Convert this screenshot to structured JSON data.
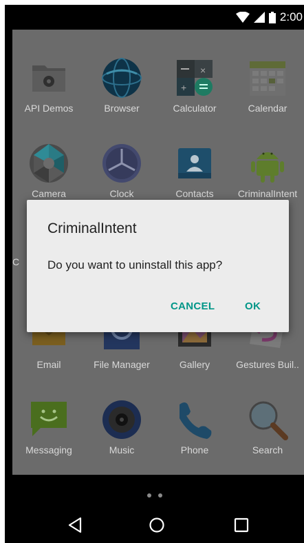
{
  "status_bar": {
    "time": "2:00",
    "icons": [
      "wifi-icon",
      "cell-signal-icon",
      "battery-icon"
    ]
  },
  "apps": [
    [
      {
        "label": "API Demos",
        "icon": "folder-gear-icon"
      },
      {
        "label": "Browser",
        "icon": "globe-icon"
      },
      {
        "label": "Calculator",
        "icon": "calculator-icon"
      },
      {
        "label": "Calendar",
        "icon": "calendar-icon"
      }
    ],
    [
      {
        "label": "Camera",
        "icon": "camera-aperture-icon"
      },
      {
        "label": "Clock",
        "icon": "clock-icon"
      },
      {
        "label": "Contacts",
        "icon": "contacts-icon"
      },
      {
        "label": "CriminalIntent",
        "icon": "android-icon"
      }
    ],
    [
      {
        "label": "C",
        "icon": "hidden-app-icon"
      }
    ],
    [
      {
        "label": "Email",
        "icon": "email-icon"
      },
      {
        "label": "File Manager",
        "icon": "file-manager-icon"
      },
      {
        "label": "Gallery",
        "icon": "gallery-icon"
      },
      {
        "label": "Gestures Buil..",
        "icon": "gestures-icon"
      }
    ],
    [
      {
        "label": "Messaging",
        "icon": "messaging-icon"
      },
      {
        "label": "Music",
        "icon": "music-icon"
      },
      {
        "label": "Phone",
        "icon": "phone-icon"
      },
      {
        "label": "Search",
        "icon": "search-icon"
      }
    ]
  ],
  "dialog": {
    "title": "CriminalIntent",
    "message": "Do you want to uninstall this app?",
    "cancel_label": "CANCEL",
    "ok_label": "OK",
    "accent_color": "#009688"
  },
  "nav": {
    "icons": [
      "back-icon",
      "home-icon",
      "recents-icon"
    ]
  }
}
